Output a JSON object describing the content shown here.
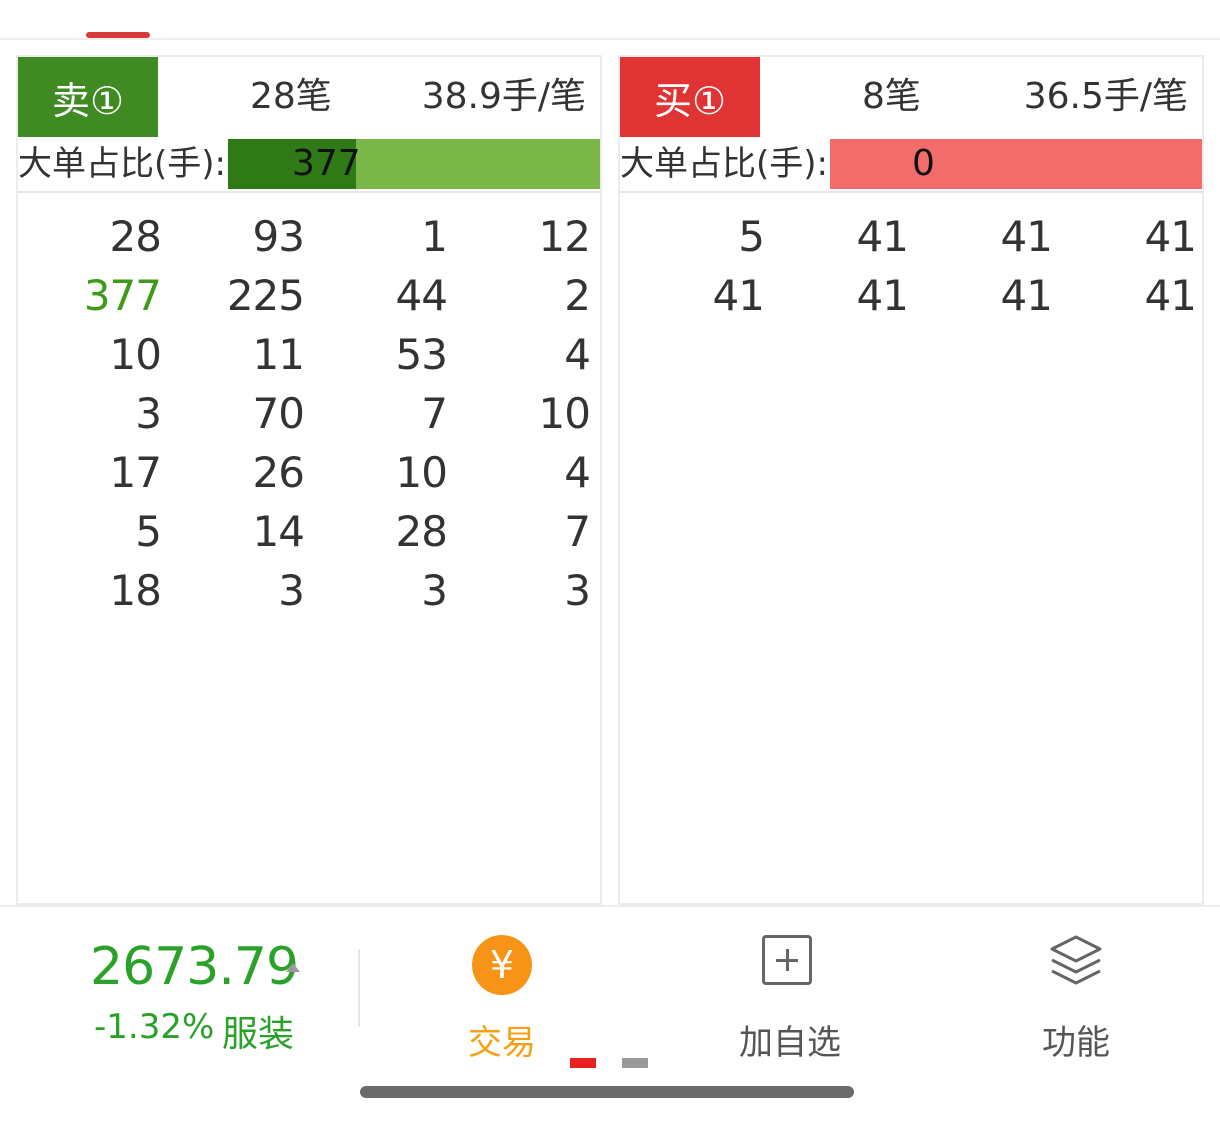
{
  "sell_panel": {
    "badge": "卖①",
    "count": "28笔",
    "avg": "38.9手/笔",
    "ratio_label": "大单占比(手):",
    "ratio_value": "377",
    "rows": [
      [
        "28",
        "93",
        "1",
        "12"
      ],
      [
        "377",
        "225",
        "44",
        "2"
      ],
      [
        "10",
        "11",
        "53",
        "4"
      ],
      [
        "3",
        "70",
        "7",
        "10"
      ],
      [
        "17",
        "26",
        "10",
        "4"
      ],
      [
        "5",
        "14",
        "28",
        "7"
      ],
      [
        "18",
        "3",
        "3",
        "3"
      ]
    ],
    "highlight_color": "#3f9a1a"
  },
  "buy_panel": {
    "badge": "买①",
    "count": "8笔",
    "avg": "36.5手/笔",
    "ratio_label": "大单占比(手):",
    "ratio_value": "0",
    "rows": [
      [
        "5",
        "41",
        "41",
        "41"
      ],
      [
        "41",
        "41",
        "41",
        "41"
      ]
    ]
  },
  "bottom_bar": {
    "price": "2673.79",
    "change": "-1.32%",
    "sector": "服装",
    "trade_icon_glyph": "¥",
    "trade_label": "交易",
    "watch_label": "加自选",
    "func_label": "功能"
  },
  "colors": {
    "sell_green": "#3f8a22",
    "buy_red": "#e03434",
    "quote_green": "#2aa22a",
    "trade_orange": "#f79418"
  }
}
